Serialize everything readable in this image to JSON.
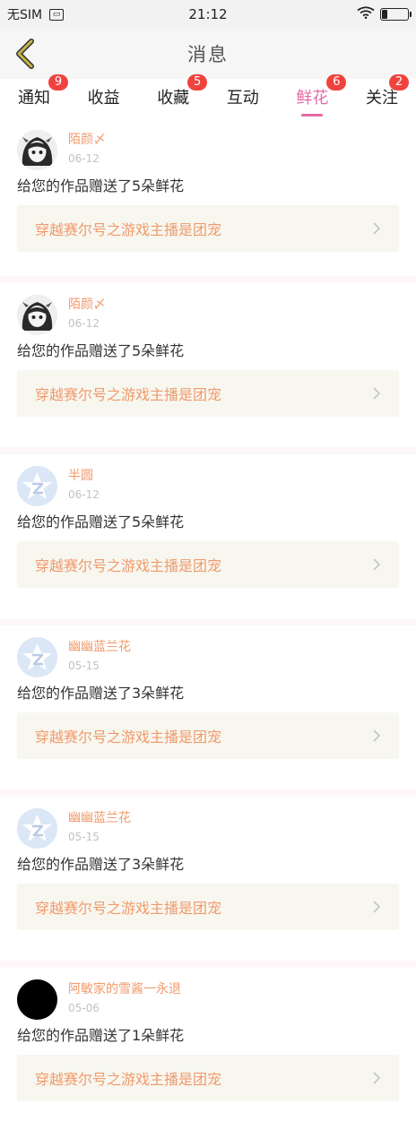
{
  "status_bar": {
    "carrier": "无SIM",
    "time": "21:12"
  },
  "header": {
    "title": "消息"
  },
  "tabs": [
    {
      "label": "通知",
      "badge": "9",
      "active": false
    },
    {
      "label": "收益",
      "badge": "",
      "active": false
    },
    {
      "label": "收藏",
      "badge": "5",
      "active": false
    },
    {
      "label": "互动",
      "badge": "",
      "active": false
    },
    {
      "label": "鲜花",
      "badge": "6",
      "active": true
    },
    {
      "label": "关注",
      "badge": "2",
      "active": false
    }
  ],
  "messages": [
    {
      "user": "陌颜〆",
      "date": "06-12",
      "text": "给您的作品赠送了5朵鲜花",
      "work": "穿越赛尔号之游戏主播是团宠",
      "avatar": "anime-girl-avatar"
    },
    {
      "user": "陌颜〆",
      "date": "06-12",
      "text": "给您的作品赠送了5朵鲜花",
      "work": "穿越赛尔号之游戏主播是团宠",
      "avatar": "anime-girl-avatar"
    },
    {
      "user": "半圆",
      "date": "06-12",
      "text": "给您的作品赠送了5朵鲜花",
      "work": "穿越赛尔号之游戏主播是团宠",
      "avatar": "default-avatar"
    },
    {
      "user": "幽幽蓝兰花",
      "date": "05-15",
      "text": "给您的作品赠送了3朵鲜花",
      "work": "穿越赛尔号之游戏主播是团宠",
      "avatar": "default-avatar"
    },
    {
      "user": "幽幽蓝兰花",
      "date": "05-15",
      "text": "给您的作品赠送了3朵鲜花",
      "work": "穿越赛尔号之游戏主播是团宠",
      "avatar": "default-avatar"
    },
    {
      "user": "阿敏家的雪酱一永退",
      "date": "05-06",
      "text": "给您的作品赠送了1朵鲜花",
      "work": "穿越赛尔号之游戏主播是团宠",
      "avatar": "black-avatar"
    }
  ],
  "colors": {
    "accent_pink": "#e36aa5",
    "name_orange": "#f19a6b",
    "badge_red": "#f0433f",
    "back_arrow": "#c8b54a"
  }
}
